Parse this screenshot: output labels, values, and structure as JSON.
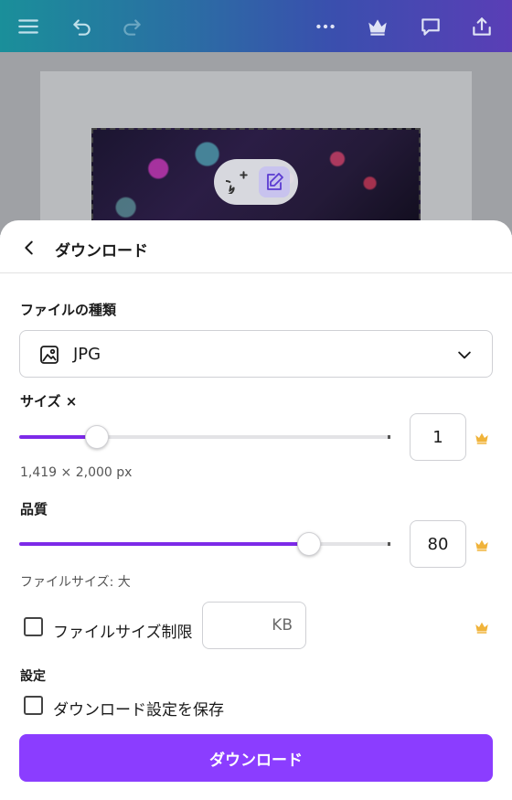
{
  "sheet": {
    "title": "ダウンロード",
    "file_type_label": "ファイルの種類",
    "file_type_value": "JPG",
    "size_label": "サイズ ×",
    "size_value": "1",
    "size_slider_fraction": 0.21,
    "dimensions_text": "1,419 × 2,000 px",
    "quality_label": "品質",
    "quality_value": "80",
    "quality_slider_fraction": 0.78,
    "file_size_text": "ファイルサイズ: 大",
    "file_size_limit_label": "ファイルサイズ制限",
    "file_size_limit_unit": "KB",
    "settings_label": "設定",
    "save_settings_label": "ダウンロード設定を保存",
    "download_button_label": "ダウンロード"
  },
  "colors": {
    "accent": "#8b3dff",
    "slider_fill": "#7d2ae8",
    "crown": "#f0b33a"
  },
  "icons": [
    "menu-icon",
    "undo-icon",
    "redo-icon",
    "more-icon",
    "crown-icon",
    "comment-icon",
    "share-icon",
    "add-comment-icon",
    "edit-icon",
    "back-icon",
    "image-icon",
    "chevron-down-icon"
  ]
}
